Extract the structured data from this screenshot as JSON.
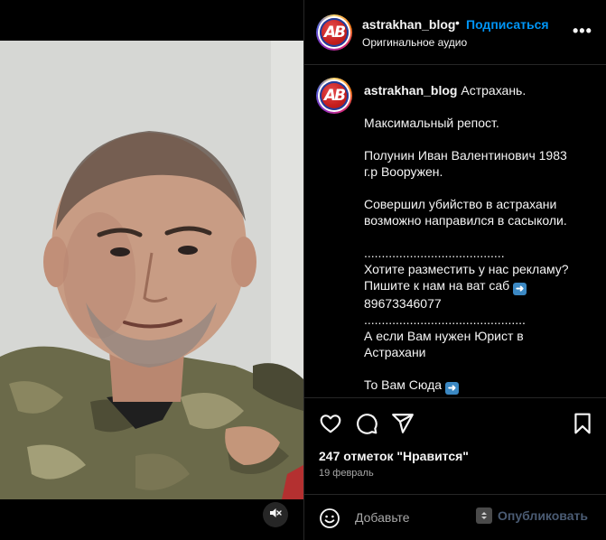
{
  "post": {
    "username": "astrakhan_blog",
    "separator": "•",
    "follow_label": "Подписаться",
    "audio_label": "Оригинальное аудио",
    "more_label": "•••",
    "avatar_text": "AB"
  },
  "caption": {
    "username": "astrakhan_blog",
    "lines": [
      "Астрахань.",
      "",
      "Максимальный репост.",
      "",
      "Полунин Иван Валентинович 1983",
      "г.р Вооружен.",
      "",
      "Совершил убийство в астрахани",
      "возможно направился в сасыколи.",
      "",
      "........................................",
      "Хотите разместить у нас рекламу?",
      "Пишите к нам на ват саб",
      "89673346077",
      "..............................................",
      "А если Вам нужен Юрист в",
      "Астрахани",
      "",
      "То Вам Сюда"
    ],
    "arrow_emoji": "➜"
  },
  "actions": {
    "like_icon": "heart-icon",
    "comment_icon": "comment-icon",
    "share_icon": "send-icon",
    "save_icon": "bookmark-icon"
  },
  "likes_text": "247 отметок \"Нравится\"",
  "date_text": "19 февраль",
  "comment": {
    "placeholder": "Добавьте",
    "publish_label": "Опубликовать"
  },
  "media": {
    "mute_icon": "speaker-muted-icon"
  },
  "colors": {
    "background": "#000000",
    "link_blue": "#0095f6",
    "divider": "#262626",
    "muted_text": "#a8a8a8"
  }
}
